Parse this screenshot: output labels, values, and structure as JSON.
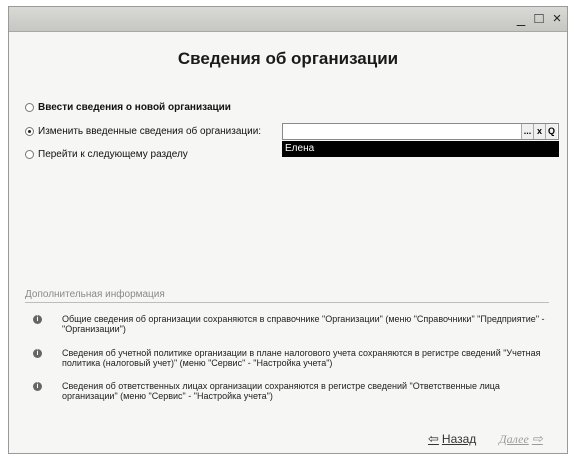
{
  "window": {
    "buttons": {
      "minimize": "_",
      "maximize": "□",
      "close": "×"
    }
  },
  "heading": "Сведения об организации",
  "options": [
    {
      "label": "Ввести сведения о новой организации",
      "selected": false,
      "bold": true
    },
    {
      "label": "Изменить введенные сведения об организации:",
      "selected": true,
      "bold": false
    },
    {
      "label": "Перейти к следующему разделу",
      "selected": false,
      "bold": false
    }
  ],
  "org_field": {
    "value": "",
    "buttons": {
      "select": "...",
      "clear": "x",
      "open": "Q"
    },
    "suggestion": "Елена"
  },
  "info": {
    "title": "Дополнительная информация",
    "items": [
      "Общие сведения об организации сохраняются в справочнике \"Организации\" (меню \"Справочники\" \"Предприятие\" - \"Организации\")",
      "Сведения об учетной политике организации в плане налогового учета сохраняются в регистре сведений \"Учетная политика (налоговый учет)\" (меню \"Сервис\" - \"Настройка учета\")",
      "Сведения об ответственных лицах организации  сохраняются в регистре сведений \"Ответственные лица организации\" (меню \"Сервис\" - \"Настройка учета\")"
    ],
    "icon_glyph": "i"
  },
  "nav": {
    "back": "Назад",
    "next": "Далее"
  }
}
